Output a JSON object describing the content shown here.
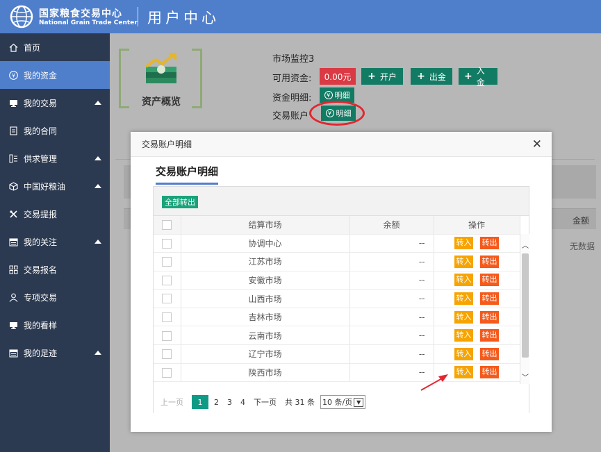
{
  "header": {
    "brand_cn": "国家粮食交易中心",
    "brand_en": "National Grain Trade Center",
    "section": "用户中心"
  },
  "sidebar": {
    "items": [
      {
        "label": "首页",
        "icon": "home-icon",
        "active": false,
        "caret": false
      },
      {
        "label": "我的资金",
        "icon": "yen-icon",
        "active": true,
        "caret": false
      },
      {
        "label": "我的交易",
        "icon": "monitor-icon",
        "active": false,
        "caret": true
      },
      {
        "label": "我的合同",
        "icon": "document-icon",
        "active": false,
        "caret": false
      },
      {
        "label": "供求管理",
        "icon": "list-icon",
        "active": false,
        "caret": true
      },
      {
        "label": "中国好粮油",
        "icon": "cube-icon",
        "active": false,
        "caret": true
      },
      {
        "label": "交易提报",
        "icon": "tools-icon",
        "active": false,
        "caret": false
      },
      {
        "label": "我的关注",
        "icon": "calendar-icon",
        "active": false,
        "caret": true
      },
      {
        "label": "交易报名",
        "icon": "grid-icon",
        "active": false,
        "caret": false
      },
      {
        "label": "专项交易",
        "icon": "user-icon",
        "active": false,
        "caret": false
      },
      {
        "label": "我的看样",
        "icon": "monitor-icon",
        "active": false,
        "caret": false
      },
      {
        "label": "我的足迹",
        "icon": "calendar-icon",
        "active": false,
        "caret": true
      }
    ]
  },
  "summary": {
    "title": "资产概览",
    "account_name": "市场监控3",
    "available_label": "可用资金:",
    "available_value": "0.00元",
    "open_btn": "开户",
    "withdraw_btn": "出金",
    "deposit_btn": "入金",
    "fund_detail_label": "资金明细:",
    "trade_account_label": "交易账户",
    "detail_btn": "明细"
  },
  "background": {
    "amount_header": "金额",
    "no_data": "无数据"
  },
  "modal": {
    "header": "交易账户明细",
    "title": "交易账户明细",
    "transfer_all": "全部转出",
    "columns": [
      "结算市场",
      "余额",
      "操作"
    ],
    "btn_in": "转入",
    "btn_out": "转出",
    "rows": [
      {
        "market": "协调中心",
        "balance": "--"
      },
      {
        "market": "江苏市场",
        "balance": "--"
      },
      {
        "market": "安徽市场",
        "balance": "--"
      },
      {
        "market": "山西市场",
        "balance": "--"
      },
      {
        "market": "吉林市场",
        "balance": "--"
      },
      {
        "market": "云南市场",
        "balance": "--"
      },
      {
        "market": "辽宁市场",
        "balance": "--"
      },
      {
        "market": "陕西市场",
        "balance": "--"
      }
    ],
    "pager": {
      "prev": "上一页",
      "pages": [
        "1",
        "2",
        "3",
        "4"
      ],
      "current": "1",
      "next": "下一页",
      "total": "共 31 条",
      "page_size": "10 条/页"
    }
  },
  "colors": {
    "header_blue": "#4f7ecb",
    "sidebar": "#2c3a51",
    "teal": "#127b64",
    "red": "#d93a43",
    "in_btn": "#f7a400",
    "out_btn": "#f55a1c"
  }
}
